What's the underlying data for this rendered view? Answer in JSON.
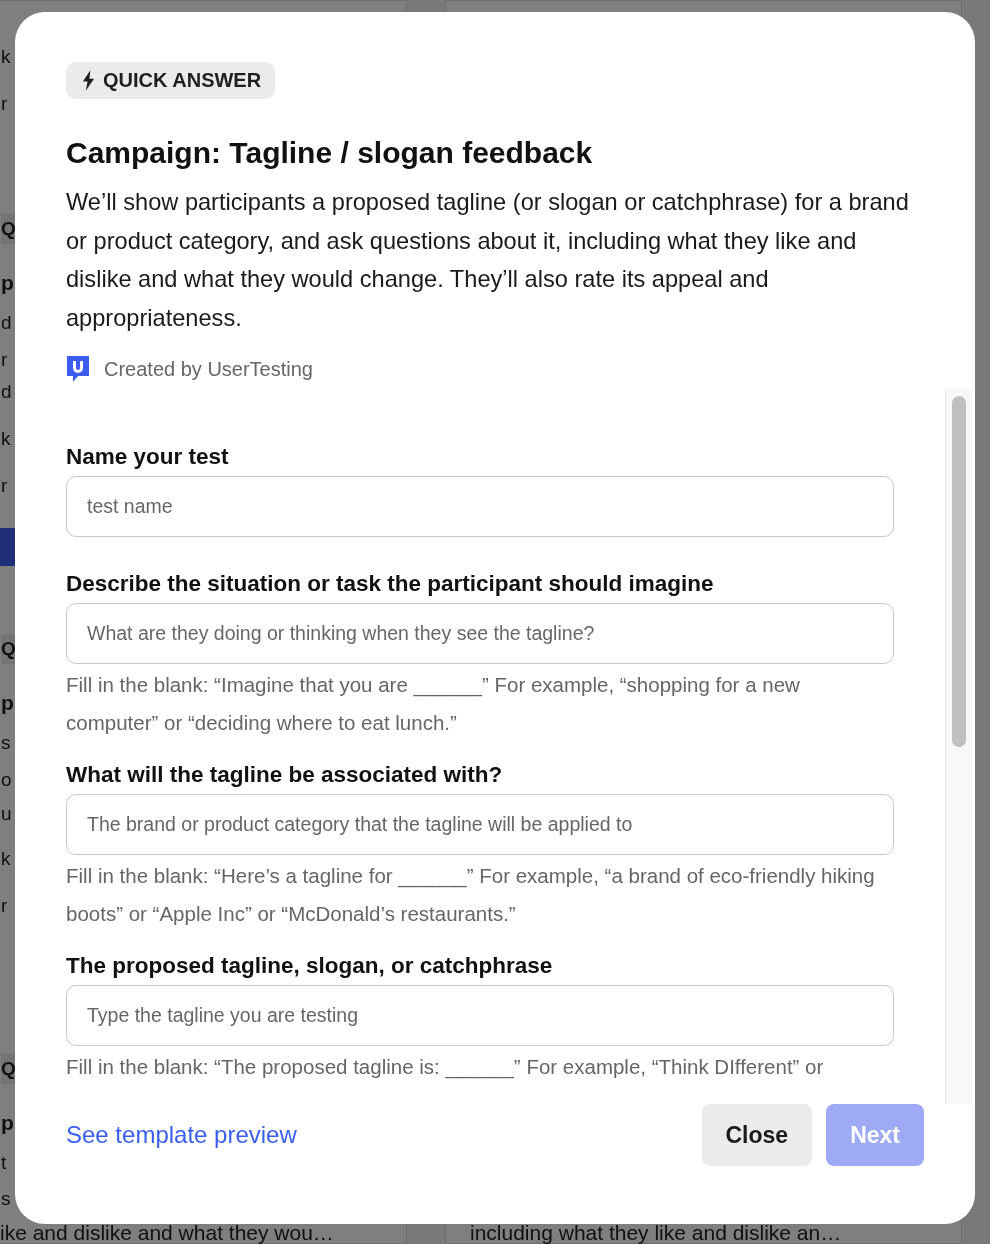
{
  "backdrop": {
    "fragments": [
      {
        "text": "k",
        "kind": "text"
      },
      {
        "text": "r",
        "kind": "text"
      },
      {
        "text": "Q",
        "kind": "badge"
      },
      {
        "text": "p",
        "kind": "heading"
      },
      {
        "text": "d",
        "kind": "text"
      },
      {
        "text": "r",
        "kind": "text"
      },
      {
        "text": "d",
        "kind": "text"
      },
      {
        "text": "k",
        "kind": "text"
      },
      {
        "text": "r",
        "kind": "text"
      },
      {
        "text": "Q",
        "kind": "badge"
      },
      {
        "text": "p",
        "kind": "heading"
      },
      {
        "text": "s",
        "kind": "text"
      },
      {
        "text": "o",
        "kind": "text"
      },
      {
        "text": "u",
        "kind": "text"
      },
      {
        "text": "k",
        "kind": "text"
      },
      {
        "text": "r",
        "kind": "text"
      },
      {
        "text": "Q",
        "kind": "badge"
      },
      {
        "text": "p",
        "kind": "heading"
      },
      {
        "text": "t",
        "kind": "text"
      },
      {
        "text": "s",
        "kind": "text"
      }
    ],
    "bottom_texts": [
      "ike and dislike and what they wou…",
      "including what they like and dislike an…"
    ]
  },
  "badge": {
    "label": "QUICK ANSWER"
  },
  "title": "Campaign: Tagline / slogan feedback",
  "description": "We’ll show participants a proposed tagline (or slogan or catchphrase) for a brand or product category, and ask questions about it, including what they like and dislike and what they would change. They’ll also rate its appeal and appropriateness.",
  "creator": "Created by UserTesting",
  "fields": [
    {
      "label": "Name your test",
      "placeholder": "test name"
    },
    {
      "label": "Describe the situation or task the participant should imagine",
      "placeholder": "What are they doing or thinking when they see the tagline?",
      "help": "Fill in the blank: “Imagine that you are ______” For example, “shopping for a new computer” or “deciding where to eat lunch.”"
    },
    {
      "label": "What will the tagline be associated with?",
      "placeholder": "The brand or product category that the tagline will be applied to",
      "help": "Fill in the blank: “Here’s a tagline for ______” For example, “a brand of eco-friendly hiking boots” or “Apple Inc” or “McDonald’s restaurants.”"
    },
    {
      "label": "The proposed tagline, slogan, or catchphrase",
      "placeholder": "Type the tagline you are testing",
      "help": "Fill in the blank: “The proposed tagline is: ______” For example, “Think DIfferent” or"
    }
  ],
  "footer": {
    "link": "See template preview",
    "buttons": [
      {
        "label": "Close",
        "kind": "secondary",
        "disabled": false
      },
      {
        "label": "Next",
        "kind": "primary",
        "disabled": true
      }
    ]
  }
}
